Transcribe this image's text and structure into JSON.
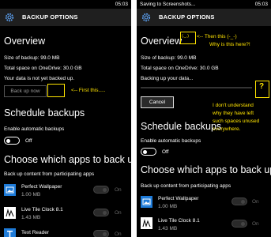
{
  "colors": {
    "annotation": "#ffe400",
    "app_blue": "#1e7bd8",
    "titlebar": "#1f1f1f"
  },
  "left": {
    "status": {
      "left": "",
      "time": "05:03"
    },
    "title": "BACKUP OPTIONS",
    "overview_heading": "Overview",
    "size_of_backup": "Size of backup: 99.0 MB",
    "total_space": "Total space on OneDrive: 30.0 GB",
    "not_backed_up": "Your data is not yet backed up.",
    "backup_now_label": "Back up now",
    "annotation": "<-- First this.....",
    "schedule_heading": "Schedule backups",
    "enable_auto": "Enable automatic backups",
    "toggle_state": "Off",
    "choose_heading": "Choose which apps to back up",
    "participating": "Back up content from participating apps",
    "apps": [
      {
        "name": "Perfect Wallpaper",
        "size": "1.00 MB",
        "state": "On",
        "icon": "picture-icon"
      },
      {
        "name": "Live Tile Clock 8.1",
        "size": "1.43 MB",
        "state": "On",
        "icon": "clock-icon"
      },
      {
        "name": "Text Reader",
        "size": "",
        "state": "On",
        "icon": "text-icon"
      }
    ]
  },
  "right": {
    "status": {
      "left": "Saving to Screenshots...",
      "time": "05:03"
    },
    "title": "BACKUP OPTIONS",
    "overview_heading": "Overview",
    "inline_box_text": "(._.)",
    "annotation_top_line1": "<-- Then this (-_-)",
    "annotation_top_line2": "Why is this here?!",
    "size_of_backup": "Size of backup: 99.0 MB",
    "total_space": "Total space on OneDrive: 30.0 GB",
    "backing_up": "Backing up your data...",
    "progress": 0.0,
    "cancel_label": "Cancel",
    "question_mark": "?",
    "annotation_side": [
      "I don't understand",
      "why they have left",
      "such spaces unused",
      "everywhere."
    ],
    "schedule_heading": "Schedule backups",
    "enable_auto": "Enable automatic backups",
    "toggle_state": "Off",
    "choose_heading": "Choose which apps to back up",
    "participating": "Back up content from participating apps",
    "apps": [
      {
        "name": "Perfect Wallpaper",
        "size": "1.00 MB",
        "state": "On",
        "icon": "picture-icon"
      },
      {
        "name": "Live Tile Clock 8.1",
        "size": "1.43 MB",
        "state": "On",
        "icon": "clock-icon"
      }
    ]
  }
}
